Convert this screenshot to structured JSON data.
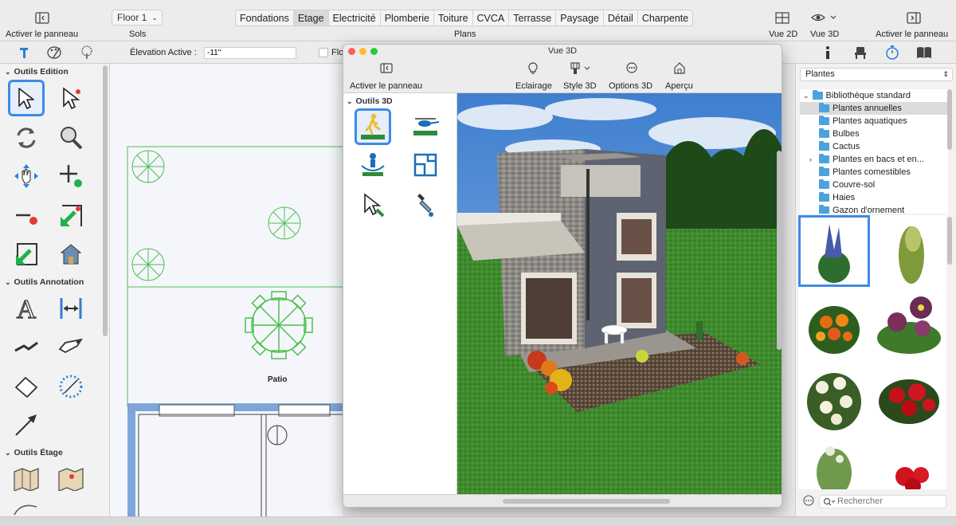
{
  "toolbar": {
    "activate_panel_left": "Activer le panneau",
    "floor_select": "Floor 1",
    "sols": "Sols",
    "plans_label": "Plans",
    "plans_tabs": [
      "Fondations",
      "Etage",
      "Electricité",
      "Plomberie",
      "Toiture",
      "CVCA",
      "Terrasse",
      "Paysage",
      "Détail",
      "Charpente"
    ],
    "active_tab": "Etage",
    "view2d": "Vue 2D",
    "view3d": "Vue 3D",
    "activate_panel_right": "Activer le panneau"
  },
  "subbar": {
    "elevation_label": "Élevation Active :",
    "elevation_value": "-11\"",
    "checkbox_label_partial": "Flo"
  },
  "left_panel": {
    "section_edit": "Outils Edition",
    "section_annotation": "Outils Annotation",
    "section_floor": "Outils Étage"
  },
  "canvas": {
    "room_label": "Patio"
  },
  "window3d": {
    "title": "Vue 3D",
    "activate_panel": "Activer le panneau",
    "lighting": "Eclairage",
    "style3d": "Style 3D",
    "options3d": "Options 3D",
    "preview": "Aperçu",
    "tools_section": "Outils 3D"
  },
  "right_panel": {
    "library_select": "Plantes",
    "tree": {
      "root": "Bibliothèque standard",
      "items": [
        "Plantes annuelles",
        "Plantes aquatiques",
        "Bulbes",
        "Cactus",
        "Plantes en bacs et en...",
        "Plantes comestibles",
        "Couvre-sol",
        "Haies",
        "Gazon d'ornement"
      ],
      "selected": "Plantes annuelles"
    },
    "search_placeholder": "Rechercher"
  },
  "colors": {
    "accent": "#3d8be8",
    "folder": "#4aa3df",
    "plan_lines": "#4cc04c",
    "wall": "#7fa6d8"
  }
}
